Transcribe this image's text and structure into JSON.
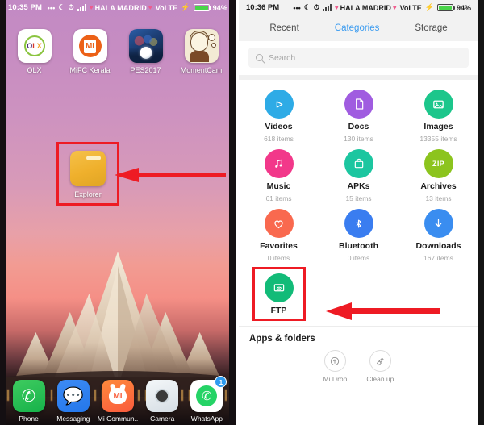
{
  "left_phone": {
    "status_bar": {
      "time": "10:35 PM",
      "dots_icon": "more-dots-icon",
      "dnd_icon": "moon-icon",
      "alarm_icon": "alarm-icon",
      "signal_icon": "signal-bars-icon",
      "carrier": "HALA MADRID",
      "network": "VoLTE",
      "charging_icon": "bolt-icon",
      "battery": "94%"
    },
    "apps": [
      {
        "label": "OLX",
        "icon": "olx-app-icon"
      },
      {
        "label": "MiFC Kerala",
        "icon": "mifc-kerala-app-icon"
      },
      {
        "label": "PES2017",
        "icon": "pes2017-app-icon"
      },
      {
        "label": "MomentCam",
        "icon": "momentcam-app-icon"
      }
    ],
    "explorer": {
      "label": "Explorer",
      "icon": "folder-icon",
      "highlight_color": "#ee1b24"
    },
    "dock": [
      {
        "label": "Phone",
        "icon": "phone-icon",
        "badge": ""
      },
      {
        "label": "Messaging",
        "icon": "message-bubble-icon",
        "badge": ""
      },
      {
        "label": "Mi Commun..",
        "icon": "mi-community-icon",
        "badge": ""
      },
      {
        "label": "Camera",
        "icon": "camera-icon",
        "badge": ""
      },
      {
        "label": "WhatsApp",
        "icon": "whatsapp-icon",
        "badge": "1"
      }
    ]
  },
  "right_phone": {
    "status_bar": {
      "time": "10:36 PM",
      "dots_icon": "more-dots-icon",
      "dnd_icon": "moon-icon",
      "alarm_icon": "alarm-icon",
      "signal_icon": "signal-bars-icon",
      "carrier": "HALA MADRID",
      "network": "VoLTE",
      "charging_icon": "bolt-icon",
      "battery": "94%"
    },
    "tabs": [
      {
        "label": "Recent",
        "active": false
      },
      {
        "label": "Categories",
        "active": true
      },
      {
        "label": "Storage",
        "active": false
      }
    ],
    "search": {
      "placeholder": "Search",
      "value": "",
      "icon": "search-icon"
    },
    "categories": [
      {
        "name": "Videos",
        "count": "618 items",
        "icon": "play-icon",
        "color": "#2eabe6"
      },
      {
        "name": "Docs",
        "count": "130 items",
        "icon": "document-icon",
        "color": "#a05ce0"
      },
      {
        "name": "Images",
        "count": "13355 items",
        "icon": "image-icon",
        "color": "#1cc68b"
      },
      {
        "name": "Music",
        "count": "61 items",
        "icon": "music-note-icon",
        "color": "#f2388a"
      },
      {
        "name": "APKs",
        "count": "15 items",
        "icon": "package-icon",
        "color": "#1cc6a0"
      },
      {
        "name": "Archives",
        "count": "13 items",
        "icon": "zip-icon",
        "color": "#8cc41e",
        "icon_text": "ZIP"
      },
      {
        "name": "Favorites",
        "count": "0 items",
        "icon": "heart-icon",
        "color": "#f9694f"
      },
      {
        "name": "Bluetooth",
        "count": "0 items",
        "icon": "bluetooth-icon",
        "color": "#3a7df0"
      },
      {
        "name": "Downloads",
        "count": "167 items",
        "icon": "download-icon",
        "color": "#3a8df0"
      }
    ],
    "ftp": {
      "name": "FTP",
      "icon": "ftp-wifi-icon",
      "color": "#12bb78",
      "highlight_color": "#ee1b24"
    },
    "apps_folders_title": "Apps & folders",
    "tools": [
      {
        "label": "Mi Drop",
        "icon": "mi-drop-icon"
      },
      {
        "label": "Clean up",
        "icon": "broom-icon"
      }
    ]
  },
  "annotations": {
    "arrow_color": "#ee1b24",
    "arrow_left_name": "arrow-pointing-to-explorer",
    "arrow_right_name": "arrow-pointing-to-ftp"
  }
}
